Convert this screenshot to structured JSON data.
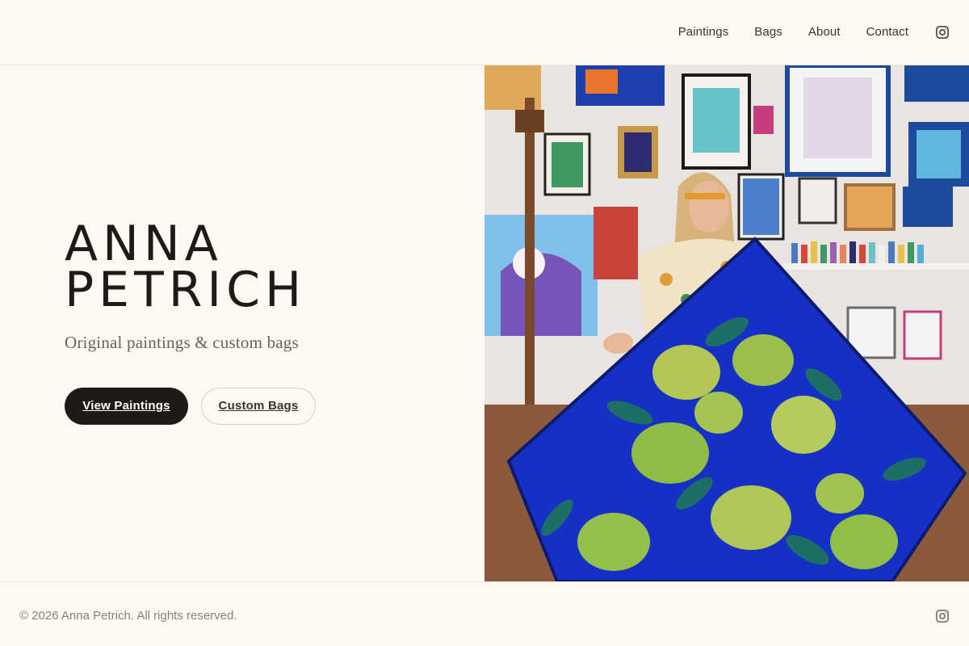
{
  "nav": {
    "items": [
      "Paintings",
      "Bags",
      "About",
      "Contact"
    ],
    "instagram_icon": "instagram-icon"
  },
  "hero": {
    "name_line1": "ANNA",
    "name_line2": "PETRICH",
    "tagline": "Original paintings & custom bags",
    "primary_button": "View Paintings",
    "secondary_button": "Custom Bags"
  },
  "footer": {
    "copyright": "© 2026 Anna Petrich. All rights reserved.",
    "instagram_icon": "instagram-icon"
  },
  "colors": {
    "background": "#fdf8f2",
    "text": "#1f1a17",
    "primary_button": "#1f1a17",
    "muted": "#8a817a"
  }
}
